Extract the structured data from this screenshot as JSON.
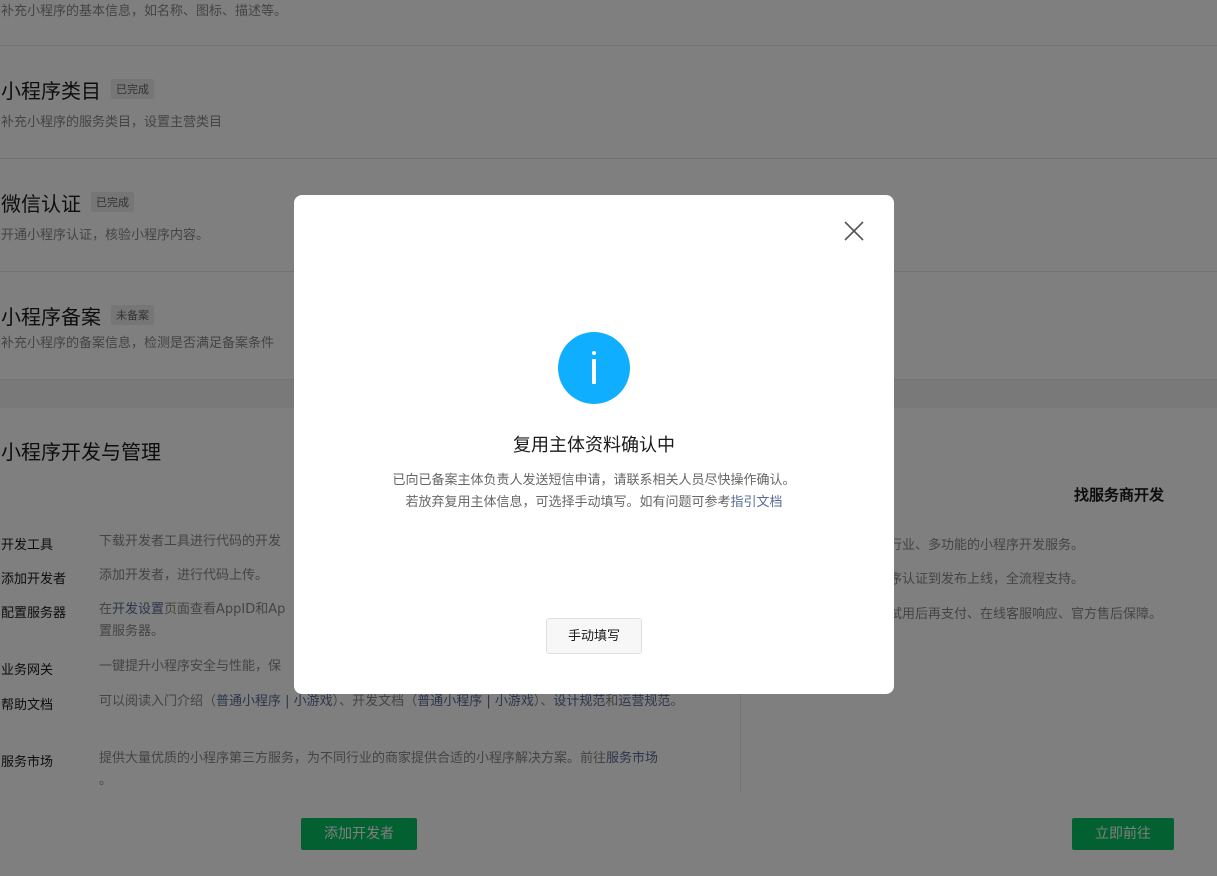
{
  "sections": [
    {
      "desc": "补充小程序的基本信息，如名称、图标、描述等。"
    },
    {
      "title": "小程序类目",
      "badge": "已完成",
      "desc": "补充小程序的服务类目，设置主营类目"
    },
    {
      "title": "微信认证",
      "badge": "已完成",
      "desc": "开通小程序认证，核验小程序内容。"
    },
    {
      "title": "小程序备案",
      "badge": "未备案",
      "desc": "补充小程序的备案信息，检测是否满足备案条件"
    }
  ],
  "dev": {
    "title": "小程序开发与管理",
    "rows": [
      {
        "label": "开发工具",
        "desc": "下载开发者工具进行代码的开发"
      },
      {
        "label": "添加开发者",
        "desc": "添加开发者，进行代码上传。"
      },
      {
        "label": "配置服务器",
        "pre": "在",
        "link": "开发设置",
        "post": "页面查看AppID和Ap",
        "line2": "置服务器。"
      },
      {
        "label": "业务网关",
        "desc": "一键提升小程序安全与性能，保"
      },
      {
        "label": "帮助文档",
        "t1": "可以阅读入门介绍（",
        "l1": "普通小程序 | 小游戏",
        "t2": "）、开发文档（",
        "l2": "普通小程序 | 小游戏",
        "t3": "）、",
        "l3": "设计规范",
        "t4": "和",
        "l4": "运营规范",
        "t5": "。"
      },
      {
        "label": "服务市场",
        "desc": "提供大量优质的小程序第三方服务，为不同行业的商家提供合适的小程序解决方案。前往",
        "link": "服务市场",
        "end": "。"
      }
    ],
    "button": "添加开发者"
  },
  "service": {
    "title": "找服务商开发",
    "lines": [
      "多行业、多功能的小程序开发服务。",
      "程序认证到发布上线，全流程支持。",
      "费试用后再支付、在线客服响应、官方售后保障。"
    ],
    "button": "立即前往"
  },
  "modal": {
    "icon": "info-icon",
    "title": "复用主体资料确认中",
    "line1": "已向已备案主体负责人发送短信申请，请联系相关人员尽快操作确认。",
    "line2_prefix": "若放弃复用主体信息，可选择手动填写。如有问题可参考",
    "line2_link": "指引文档",
    "button": "手动填写",
    "close_icon": "close-icon"
  },
  "colors": {
    "accent": "#07c160",
    "info": "#10aeff",
    "link": "#576b95"
  }
}
